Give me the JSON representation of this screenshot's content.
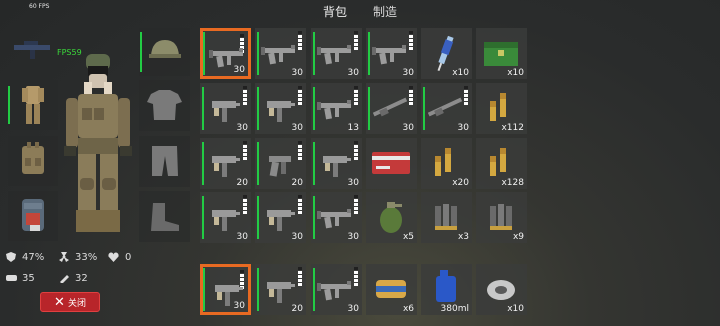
{
  "fps": "60 FPS",
  "tabs": [
    "背包",
    "制造"
  ],
  "player": {
    "fps_label": "FPS59",
    "stats": {
      "armor": "47%",
      "radiation": "33%",
      "health": "0",
      "food": "35",
      "water": "32"
    },
    "close_label": "关闭"
  },
  "equipment": [
    "helmet",
    "t-shirt",
    "pants",
    "boots"
  ],
  "grid": {
    "rows": [
      [
        {
          "icon": "rifle-icon",
          "qty": "30",
          "ammo": true,
          "selected": true
        },
        {
          "icon": "rifle-icon",
          "qty": "30",
          "ammo": true
        },
        {
          "icon": "rifle-icon",
          "qty": "30",
          "ammo": true
        },
        {
          "icon": "rifle-icon",
          "qty": "30",
          "ammo": true
        },
        {
          "icon": "syringe-icon",
          "qty": "x10"
        },
        {
          "icon": "ammo-crate-icon",
          "qty": "x10"
        }
      ],
      [
        {
          "icon": "smg-icon",
          "qty": "30",
          "ammo": true
        },
        {
          "icon": "smg-icon",
          "qty": "30",
          "ammo": true
        },
        {
          "icon": "rifle-icon",
          "qty": "13",
          "ammo": true
        },
        {
          "icon": "shotgun-icon",
          "qty": "30",
          "ammo": true
        },
        {
          "icon": "shotgun-icon",
          "qty": "30",
          "ammo": true
        },
        {
          "icon": "bullets-icon",
          "qty": "x112"
        }
      ],
      [
        {
          "icon": "smg-icon",
          "qty": "20",
          "ammo": true
        },
        {
          "icon": "pistol-icon",
          "qty": "20",
          "ammo": true
        },
        {
          "icon": "smg-icon",
          "qty": "30",
          "ammo": true
        },
        {
          "icon": "keycard-icon",
          "qty": ""
        },
        {
          "icon": "bullets-icon",
          "qty": "x20"
        },
        {
          "icon": "bullets-icon",
          "qty": "x128"
        }
      ],
      [
        {
          "icon": "smg-icon",
          "qty": "30",
          "ammo": true
        },
        {
          "icon": "smg-icon",
          "qty": "30",
          "ammo": true
        },
        {
          "icon": "rifle-icon",
          "qty": "30",
          "ammo": true
        },
        {
          "icon": "grenade-icon",
          "qty": "x5"
        },
        {
          "icon": "shells-icon",
          "qty": "x3"
        },
        {
          "icon": "shells-icon",
          "qty": "x9"
        }
      ]
    ]
  },
  "hotbar": [
    {
      "icon": "smg-icon",
      "qty": "30",
      "ammo": true,
      "selected": true
    },
    {
      "icon": "smg-icon",
      "qty": "20",
      "ammo": true
    },
    {
      "icon": "rifle-icon",
      "qty": "30",
      "ammo": true
    },
    {
      "icon": "food-can-icon",
      "qty": "x6"
    },
    {
      "icon": "fuel-can-icon",
      "qty": "380ml"
    },
    {
      "icon": "duct-tape-icon",
      "qty": "x10"
    }
  ],
  "colors": {
    "accent": "#e86a22",
    "durability": "#22cc44",
    "close": "#b8252a"
  }
}
